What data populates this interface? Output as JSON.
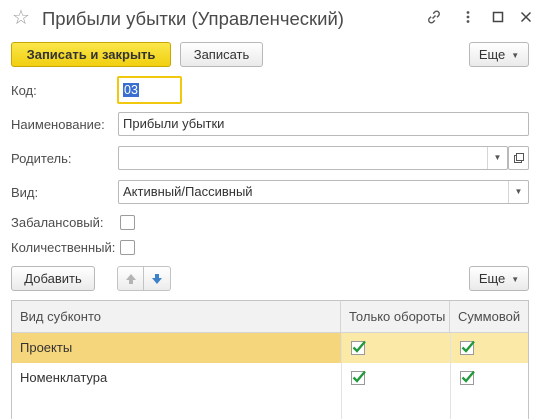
{
  "window": {
    "title": "Прибыли убытки (Управленческий)",
    "icons": [
      "star-icon",
      "link-icon",
      "more-vertical-icon",
      "maximize-icon",
      "close-icon"
    ]
  },
  "toolbar": {
    "save_close_label": "Записать и закрыть",
    "save_label": "Записать",
    "more_label": "Еще"
  },
  "form": {
    "code_label": "Код:",
    "code_value": "03",
    "name_label": "Наименование:",
    "name_value": "Прибыли убытки",
    "parent_label": "Родитель:",
    "parent_value": "",
    "kind_label": "Вид:",
    "kind_value": "Активный/Пассивный",
    "offbalance_label": "Забалансовый:",
    "offbalance_checked": false,
    "quantitative_label": "Количественный:",
    "quantitative_checked": false
  },
  "subconto_toolbar": {
    "add_label": "Добавить",
    "up_icon": "arrow-up-icon",
    "down_icon": "arrow-down-icon",
    "more_label": "Еще"
  },
  "table": {
    "columns": [
      "Вид субконто",
      "Только обороты",
      "Суммовой"
    ],
    "rows": [
      {
        "name": "Проекты",
        "turnover_only": true,
        "sum": true,
        "selected": true
      },
      {
        "name": "Номенклатура",
        "turnover_only": true,
        "sum": true,
        "selected": false
      }
    ]
  },
  "colors": {
    "primary_button": "#f5d81c",
    "selected_row": "#fbe9a8",
    "focus_border": "#f2c80f",
    "check_mark": "#1f9a3a",
    "arrow_icon": "#3d82c8"
  }
}
